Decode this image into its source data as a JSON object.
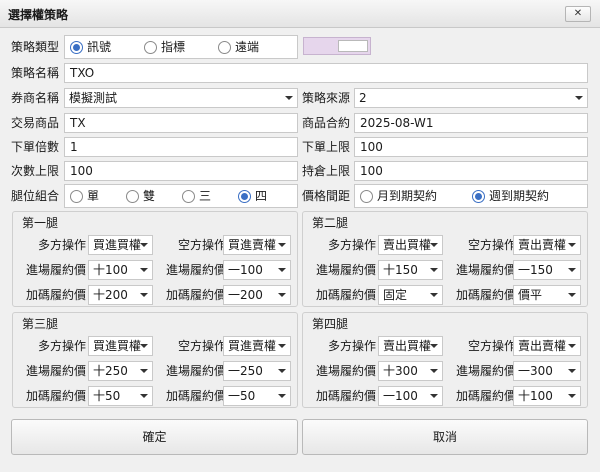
{
  "window": {
    "title": "選擇權策略",
    "close_icon": "close-icon"
  },
  "form": {
    "strategy_type": {
      "label": "策略類型",
      "options": [
        "訊號",
        "指標",
        "遠端"
      ],
      "selected": "訊號"
    },
    "strategy_name": {
      "label": "策略名稱",
      "value": "TXO"
    },
    "broker": {
      "label": "券商名稱",
      "value": "模擬測試"
    },
    "strategy_source": {
      "label": "策略來源",
      "value": "2"
    },
    "trade_product": {
      "label": "交易商品",
      "value": "TX"
    },
    "product_contract": {
      "label": "商品合約",
      "value": "2025-08-W1"
    },
    "order_multiplier": {
      "label": "下單倍數",
      "value": "1"
    },
    "order_limit": {
      "label": "下單上限",
      "value": "100"
    },
    "count_limit": {
      "label": "次數上限",
      "value": "100"
    },
    "position_limit": {
      "label": "持倉上限",
      "value": "100"
    },
    "leg_combo": {
      "label": "腿位組合",
      "options": [
        "單",
        "雙",
        "三",
        "四"
      ],
      "selected": "四"
    },
    "price_spacing": {
      "label": "價格間距",
      "options": [
        "月到期契約",
        "週到期契約"
      ],
      "selected": "週到期契約"
    }
  },
  "legs": [
    {
      "title": "第一腿",
      "long_label": "多方操作",
      "long_value": "買進買權",
      "short_label": "空方操作",
      "short_value": "買進賣權",
      "entry_label_l": "進場履約價",
      "entry_value_l": "十100",
      "entry_label_r": "進場履約價",
      "entry_value_r": "一100",
      "add_label_l": "加碼履約價",
      "add_value_l": "十200",
      "add_label_r": "加碼履約價",
      "add_value_r": "一200"
    },
    {
      "title": "第二腿",
      "long_label": "多方操作",
      "long_value": "賣出買權",
      "short_label": "空方操作",
      "short_value": "賣出賣權",
      "entry_label_l": "進場履約價",
      "entry_value_l": "十150",
      "entry_label_r": "進場履約價",
      "entry_value_r": "一150",
      "add_label_l": "加碼履約價",
      "add_value_l": "固定",
      "add_label_r": "加碼履約價",
      "add_value_r": "價平"
    },
    {
      "title": "第三腿",
      "long_label": "多方操作",
      "long_value": "買進買權",
      "short_label": "空方操作",
      "short_value": "買進賣權",
      "entry_label_l": "進場履約價",
      "entry_value_l": "十250",
      "entry_label_r": "進場履約價",
      "entry_value_r": "一250",
      "add_label_l": "加碼履約價",
      "add_value_l": "十50",
      "add_label_r": "加碼履約價",
      "add_value_r": "一50"
    },
    {
      "title": "第四腿",
      "long_label": "多方操作",
      "long_value": "賣出買權",
      "short_label": "空方操作",
      "short_value": "賣出賣權",
      "entry_label_l": "進場履約價",
      "entry_value_l": "十300",
      "entry_label_r": "進場履約價",
      "entry_value_r": "一300",
      "add_label_l": "加碼履約價",
      "add_value_l": "一100",
      "add_label_r": "加碼履約價",
      "add_value_r": "十100"
    }
  ],
  "buttons": {
    "confirm": "確定",
    "cancel": "取消"
  },
  "colors": {
    "accent": "#3a6fc4",
    "toggle_bg": "#e6d6ec"
  }
}
